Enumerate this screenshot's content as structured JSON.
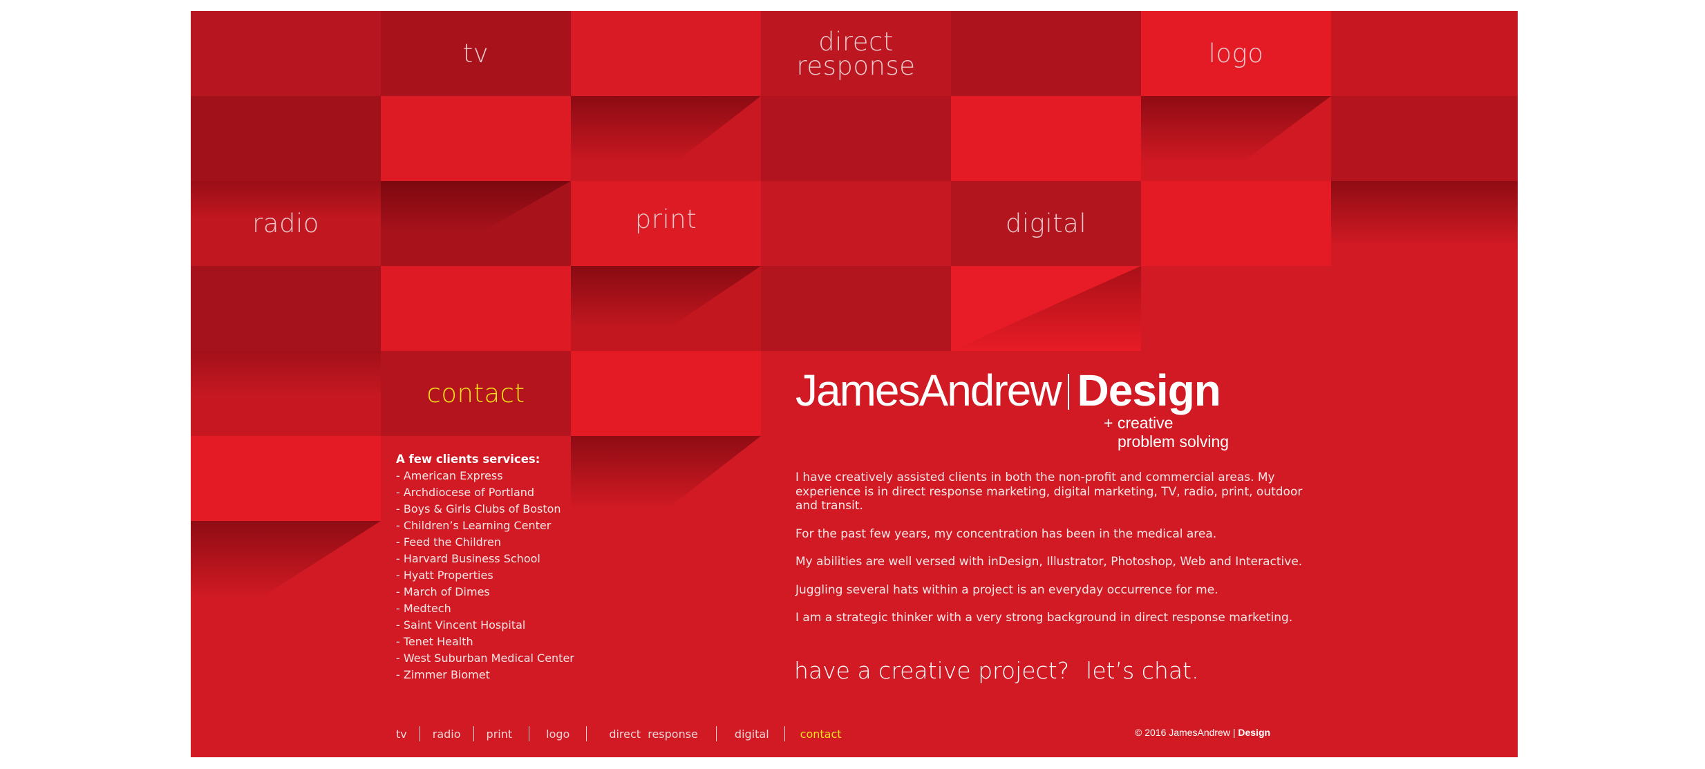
{
  "nav_tiles": {
    "tv": "tv",
    "direct_response": "direct\nresponse",
    "logo": "logo",
    "radio": "radio",
    "print": "print",
    "digital": "digital",
    "contact": "contact"
  },
  "brand": {
    "first": "James",
    "second": "Andrew",
    "third": "Design",
    "tagline_1": "+ creative",
    "tagline_2": "problem solving"
  },
  "about": [
    "I have creatively assisted clients in both the non-profit and commercial areas. My experience is in direct response marketing, digital marketing, TV, radio, print, outdoor and transit.",
    "For the past few years, my concentration has been in the medical area.",
    "My abilities are well versed with inDesign, Illustrator, Photoshop, Web and Interactive.",
    "Juggling several hats within a project is an everyday occurrence for me.",
    "I am a strategic thinker with a very strong background in direct response marketing."
  ],
  "cta": {
    "question": "have a creative project?",
    "action": "let’s chat."
  },
  "clients": {
    "heading": "A few clients services:",
    "items": [
      "- American Express",
      "- Archdiocese of Portland",
      "- Boys & Girls Clubs of Boston",
      "- Children’s Learning Center",
      "- Feed the Children",
      "- Harvard Business School",
      "- Hyatt Properties",
      "- March of Dimes",
      "- Medtech",
      "- Saint Vincent Hospital",
      "- Tenet Health",
      "- West Suburban Medical Center",
      "- Zimmer Biomet"
    ]
  },
  "footer_nav": {
    "tv": "tv",
    "radio": "radio",
    "print": "print",
    "logo": "logo",
    "direct_response": "direct  response",
    "digital": "digital",
    "contact": "contact"
  },
  "copyright": {
    "prefix": "© 2016",
    "name_light": "JamesAndrew",
    "divider": "|",
    "name_bold": "Design"
  },
  "colors": {
    "background_red": "#d11a24",
    "tile_bright": "#e41b25",
    "tile_dark": "#a8121b",
    "active_link": "#f6e21a",
    "page_white": "#ffffff"
  }
}
